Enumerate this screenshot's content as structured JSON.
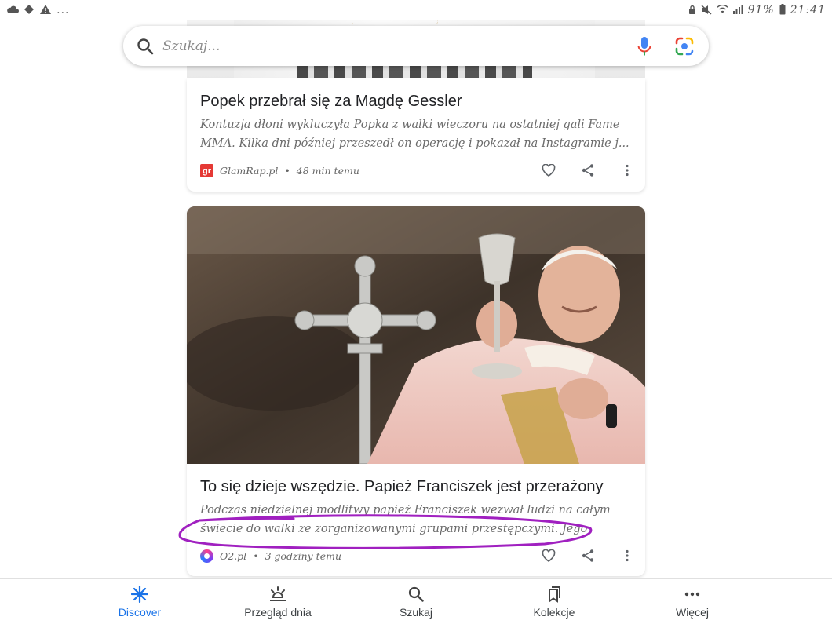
{
  "status_bar": {
    "left_icons": [
      "cloud-icon",
      "diamond-icon",
      "warning-icon",
      "more-dots-icon"
    ],
    "right_icons": [
      "lock-icon",
      "mute-icon",
      "wifi-icon",
      "signal-icon",
      "battery-icon"
    ],
    "battery": "91%",
    "time": "21:41"
  },
  "search": {
    "placeholder": "Szukaj..."
  },
  "cards": [
    {
      "title": "Popek przebrał się za Magdę Gessler",
      "snippet": "Kontuzja dłoni wykluczyła Popka z walki wieczoru na ostatniej gali Fame MMA. Kilka dni później przeszedł on operację i pokazał na Instagramie j...",
      "source": "GlamRap.pl",
      "source_logo_text": "gr",
      "time": "48 min temu"
    },
    {
      "title": "To się dzieje wszędzie. Papież Franciszek jest przerażony",
      "snippet": "Podczas niedzielnej modlitwy papież Franciszek wezwał ludzi na całym świecie do walki ze zorganizowanymi grupami przestępczymi. Jego zdaniem ...",
      "source": "O2.pl",
      "time": "3 godziny temu"
    }
  ],
  "separator": "•",
  "bottom_nav": {
    "items": [
      {
        "label": "Discover",
        "icon": "discover-asterisk-icon",
        "active": true
      },
      {
        "label": "Przegląd dnia",
        "icon": "sunrise-icon",
        "active": false
      },
      {
        "label": "Szukaj",
        "icon": "search-icon",
        "active": false
      },
      {
        "label": "Kolekcje",
        "icon": "collections-icon",
        "active": false
      },
      {
        "label": "Więcej",
        "icon": "more-dots-icon",
        "active": false
      }
    ]
  },
  "colors": {
    "accent": "#1a73e8",
    "annotation": "#a020c0",
    "source_glamrap": "#e53935"
  }
}
